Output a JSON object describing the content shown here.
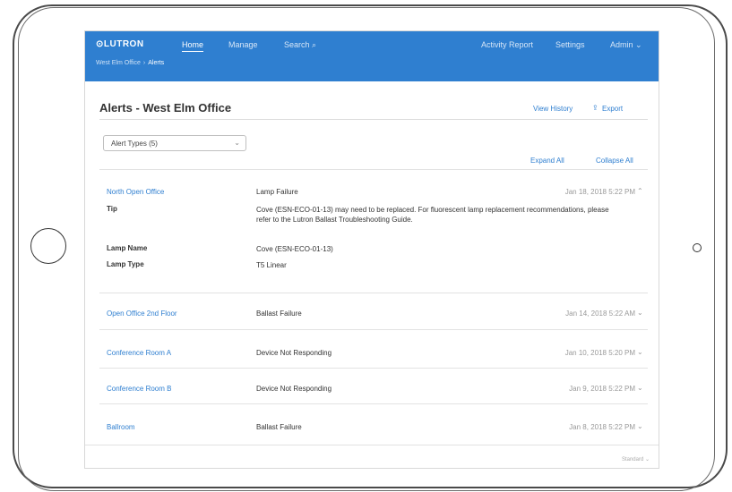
{
  "app": {
    "logo": "⊙LUTRON",
    "nav": {
      "home": "Home",
      "manage": "Manage",
      "search": "Search ⌕"
    },
    "nav_right": {
      "activity": "Activity Report",
      "settings": "Settings",
      "admin": "Admin ⌄"
    },
    "breadcrumb": {
      "site": "West Elm Office",
      "separator": "›",
      "current": "Alerts"
    }
  },
  "page": {
    "title": "Alerts - West Elm Office",
    "view_history": "View History",
    "export": "Export",
    "filter": {
      "value": "Alert Types (5)"
    },
    "expand_all": "Expand All",
    "collapse_all": "Collapse All"
  },
  "alerts": [
    {
      "location": "North Open Office",
      "type": "Lamp Failure",
      "date": "Jan 18, 2018 5:22 PM",
      "expanded": true
    },
    {
      "location": "Open Office 2nd Floor",
      "type": "Ballast Failure",
      "date": "Jan 14, 2018 5:22 AM"
    },
    {
      "location": "Conference Room A",
      "type": "Device Not Responding",
      "date": "Jan 10, 2018 5:20 PM"
    },
    {
      "location": "Conference Room B",
      "type": "Device Not Responding",
      "date": "Jan 9, 2018 5:22 PM"
    },
    {
      "location": "Ballroom",
      "type": "Ballast Failure",
      "date": "Jan 8, 2018 5:22 PM"
    }
  ],
  "details": {
    "tip_label": "Tip",
    "tip_text": "Cove (ESN-ECO-01-13) may need to be replaced. For fluorescent lamp replacement recommendations, please refer to the Lutron Ballast Troubleshooting Guide.",
    "lamp_name_label": "Lamp Name",
    "lamp_name": "Cove (ESN-ECO-01-13)",
    "lamp_type_label": "Lamp Type",
    "lamp_type": "T5 Linear"
  },
  "footer": {
    "text": "Standard ⌄"
  },
  "colors": {
    "brand": "#2f7fd0",
    "text": "#333333",
    "muted": "#999999"
  }
}
